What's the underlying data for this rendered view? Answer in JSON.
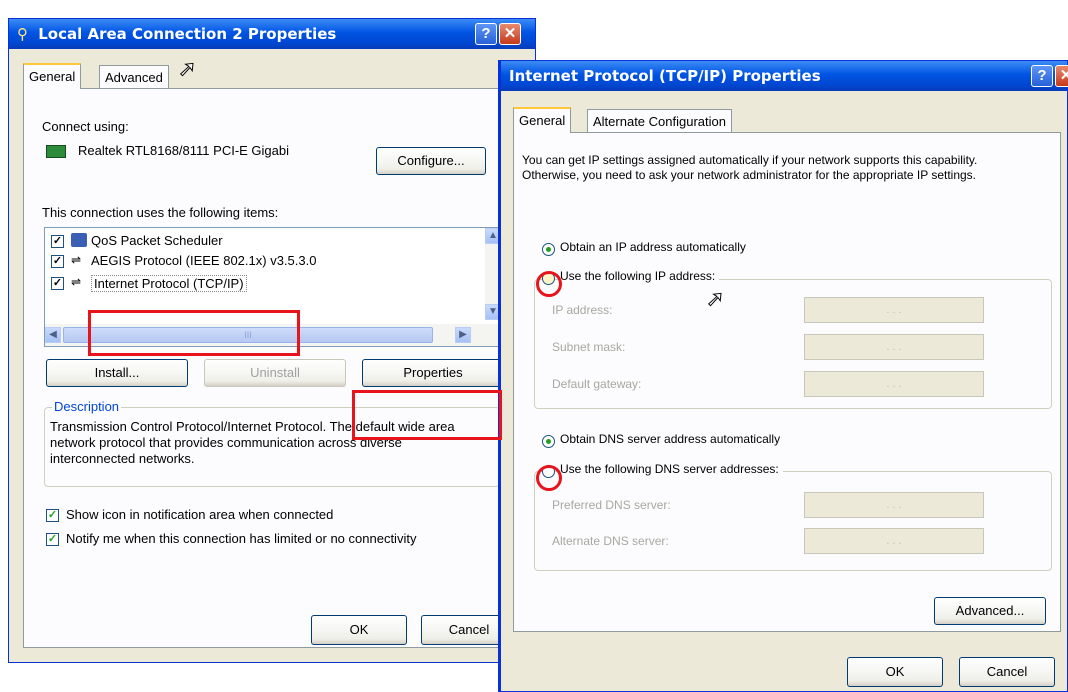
{
  "lac": {
    "title": "Local Area Connection 2 Properties",
    "tabs": [
      "General",
      "Advanced"
    ],
    "connect_using_label": "Connect using:",
    "adapter_name": "Realtek RTL8168/8111 PCI-E Gigabi",
    "configure_label": "Configure...",
    "items_label": "This connection uses the following items:",
    "items": [
      {
        "label": "QoS Packet Scheduler",
        "checked": true
      },
      {
        "label": "AEGIS Protocol (IEEE 802.1x) v3.5.3.0",
        "checked": true
      },
      {
        "label": "Internet Protocol (TCP/IP)",
        "checked": true
      }
    ],
    "scroll_thumb_glyph": "III",
    "install_label": "Install...",
    "uninstall_label": "Uninstall",
    "properties_label": "Properties",
    "description_label": "Description",
    "description_text": "Transmission Control Protocol/Internet Protocol. The default wide area network protocol that provides communication across diverse interconnected networks.",
    "show_icon_label": "Show icon in notification area when connected",
    "show_icon_checked": true,
    "notify_label": "Notify me when this connection has limited or no connectivity",
    "notify_checked": true,
    "ok_label": "OK",
    "cancel_label": "Cancel"
  },
  "tcpip": {
    "title": "Internet Protocol (TCP/IP) Properties",
    "tabs": [
      "General",
      "Alternate Configuration"
    ],
    "intro_text": "You can get IP settings assigned automatically if your network supports this capability. Otherwise, you need to ask your network administrator for the appropriate IP settings.",
    "obtain_ip_label": "Obtain an IP address automatically",
    "use_ip_label": "Use the following IP address:",
    "ip_address_label": "IP address:",
    "subnet_mask_label": "Subnet mask:",
    "default_gateway_label": "Default gateway:",
    "obtain_dns_label": "Obtain DNS server address automatically",
    "use_dns_label": "Use the following DNS server addresses:",
    "preferred_dns_label": "Preferred DNS server:",
    "alternate_dns_label": "Alternate DNS server:",
    "ip_placeholder": ".   .   .",
    "advanced_label": "Advanced...",
    "ok_label": "OK",
    "cancel_label": "Cancel"
  },
  "help_glyph": "?",
  "close_glyph": "✕",
  "colors": {
    "title_blue": "#0054e3",
    "dialog_bg": "#ece9d8",
    "annotation_red": "#e8141b"
  }
}
